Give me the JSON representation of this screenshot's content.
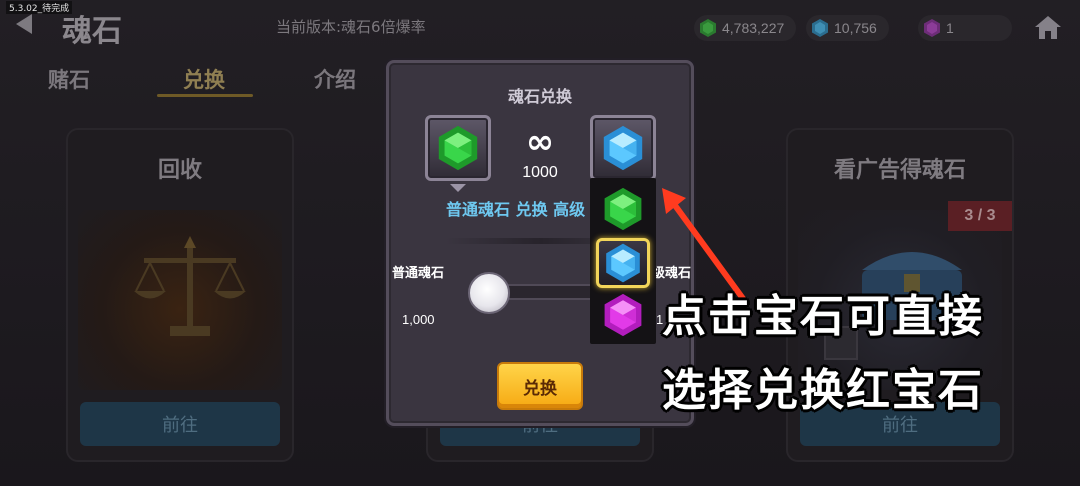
{
  "status": {
    "version_tag": "5.3.02_待完成"
  },
  "header": {
    "title": "魂石",
    "version_text": "当前版本:魂石6倍爆率",
    "currencies": [
      {
        "icon": "green-gem-icon",
        "value": "4,783,227"
      },
      {
        "icon": "blue-gem-icon",
        "value": "10,756"
      },
      {
        "icon": "purple-gem-icon",
        "value": "1"
      }
    ]
  },
  "tabs": [
    {
      "label": "赌石",
      "active": false
    },
    {
      "label": "兑换",
      "active": true
    },
    {
      "label": "介绍",
      "active": false
    }
  ],
  "cards": [
    {
      "title": "回收",
      "button": "前往"
    },
    {
      "title": "",
      "button": "前往"
    },
    {
      "title": "看广告得魂石",
      "button": "前往",
      "badge": "3 / 3"
    }
  ],
  "modal": {
    "title": "魂石兑换",
    "rate_symbol": "∞",
    "rate_value": "1000",
    "description": "普通魂石 兑换 高级",
    "from_label": "普通魂石",
    "to_label": "级魂石",
    "from_amount": "1,000",
    "to_amount": "1",
    "exchange_button": "兑换",
    "gem_options": [
      "green-gem-icon",
      "blue-gem-icon",
      "purple-gem-icon"
    ],
    "selected_option": "blue-gem-icon"
  },
  "tutorial": {
    "line1": "点击宝石可直接",
    "line2": "选择兑换红宝石"
  },
  "colors": {
    "accent_blue_text": "#6ec8f0",
    "button_gold": "#f6b41a",
    "arrow_red": "#ff3b1f",
    "green_gem": "#2fd33a",
    "blue_gem": "#4fc3ff",
    "purple_gem": "#e23ae8"
  }
}
